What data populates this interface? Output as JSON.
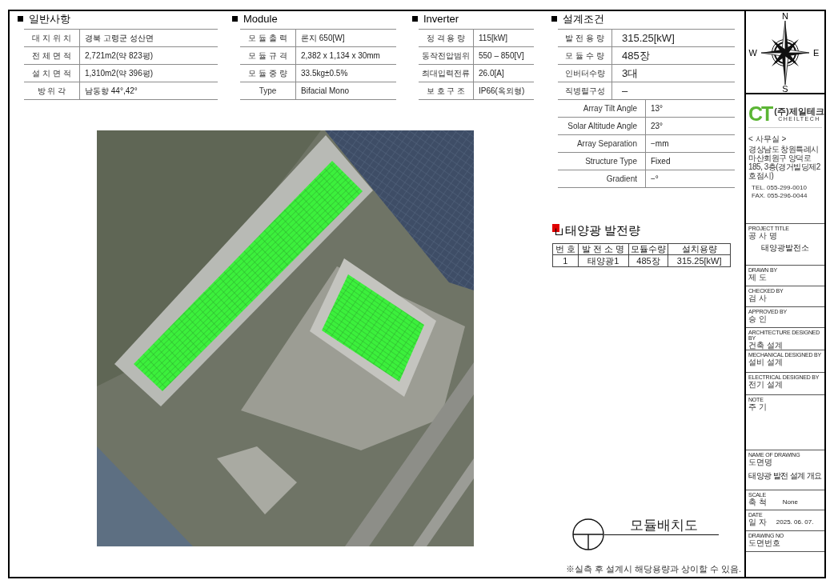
{
  "general": {
    "title": "일반사항",
    "rows": [
      {
        "label": "대 지 위 치",
        "value": "경북 고령군 성산면"
      },
      {
        "label": "전 체 면 적",
        "value": "2,721m2(약 823평)"
      },
      {
        "label": "설 치 면 적",
        "value": "1,310m2(약 396평)"
      },
      {
        "label": "방 위 각",
        "value": "남동향 44°,42°"
      }
    ]
  },
  "module": {
    "title": "Module",
    "rows": [
      {
        "label": "모 듈 출 력",
        "value": "론지 650[W]"
      },
      {
        "label": "모 듈 규 격",
        "value": "2,382 x 1,134 x 30mm"
      },
      {
        "label": "모 듈 중 량",
        "value": "33.5kg±0.5%"
      },
      {
        "label": "Type",
        "value": "Bifacial Mono"
      }
    ]
  },
  "inverter": {
    "title": "Inverter",
    "rows": [
      {
        "label": "정 격 용 량",
        "value": "115[kW]"
      },
      {
        "label": "동작전압범위",
        "value": "550 – 850[V]"
      },
      {
        "label": "최대입력전류",
        "value": "26.0[A]"
      },
      {
        "label": "보 호 구 조",
        "value": "IP66(옥외형)"
      }
    ]
  },
  "design_conditions": {
    "title": "설계조건",
    "rows": [
      {
        "label": "발 전 용 량",
        "value": "315.25[kW]"
      },
      {
        "label": "모 듈 수 량",
        "value": "485장"
      },
      {
        "label": "인버터수량",
        "value": "3대"
      },
      {
        "label": "직병렬구성",
        "value": "–"
      }
    ],
    "details": [
      {
        "label": "Array Tilt Angle",
        "value": "13°"
      },
      {
        "label": "Solar Altitude Angle",
        "value": "23°"
      },
      {
        "label": "Array Separation",
        "value": "−mm"
      },
      {
        "label": "Structure Type",
        "value": "Fixed"
      },
      {
        "label": "Gradient",
        "value": "−°"
      }
    ]
  },
  "generation": {
    "title": "태양광 발전량",
    "columns": [
      "번 호",
      "발 전 소 명",
      "모듈수량",
      "설치용량"
    ],
    "rows": [
      [
        "1",
        "태양광1",
        "485장",
        "315.25[kW]"
      ]
    ]
  },
  "drawing_title": "모듈배치도",
  "note": "※실측 후 설계시 해당용량과 상이할 수 있음.",
  "title_block": {
    "compass": {
      "north": "N",
      "west": "W",
      "east": "E",
      "south": "S"
    },
    "company": {
      "logo_mark": "CT",
      "name": "(주)제일테크",
      "name_en": "CHEILTECH",
      "office_label": "< 사무실 >",
      "address": "경상남도 창원특례시 마산회원구 양덕로 185, 3층(경거빌딩제2호점시)",
      "tel": "TEL. 055-299-0010",
      "fax": "FAX. 055-296-0044"
    },
    "fields": [
      {
        "label_en": "PROJECT TITLE",
        "label": "공 사 명",
        "value": "태양광발전소"
      },
      {
        "label_en": "DRAWN BY",
        "label": "제 도"
      },
      {
        "label_en": "CHECKED BY",
        "label": "검 사"
      },
      {
        "label_en": "APPROVED BY",
        "label": "승 인"
      },
      {
        "label_en": "ARCHITECTURE DESIGNED BY",
        "label": "건축 설계"
      },
      {
        "label_en": "MECHANICAL DESIGNED BY",
        "label": "설비 설계"
      },
      {
        "label_en": "ELECTRICAL DESIGNED BY",
        "label": "전기 설계"
      },
      {
        "label_en": "NOTE",
        "label": "주 기"
      },
      {
        "label_en": "NAME OF DRAWING",
        "label": "도면명",
        "value": "태양광 발전 설계 개요"
      },
      {
        "label_en": "SCALE",
        "label": "축 척",
        "value": "None"
      },
      {
        "label_en": "DATE",
        "label": "일 자",
        "value": "2025. 06. 07."
      },
      {
        "label_en": "DRAWING NO",
        "label": "도면번호"
      }
    ]
  }
}
